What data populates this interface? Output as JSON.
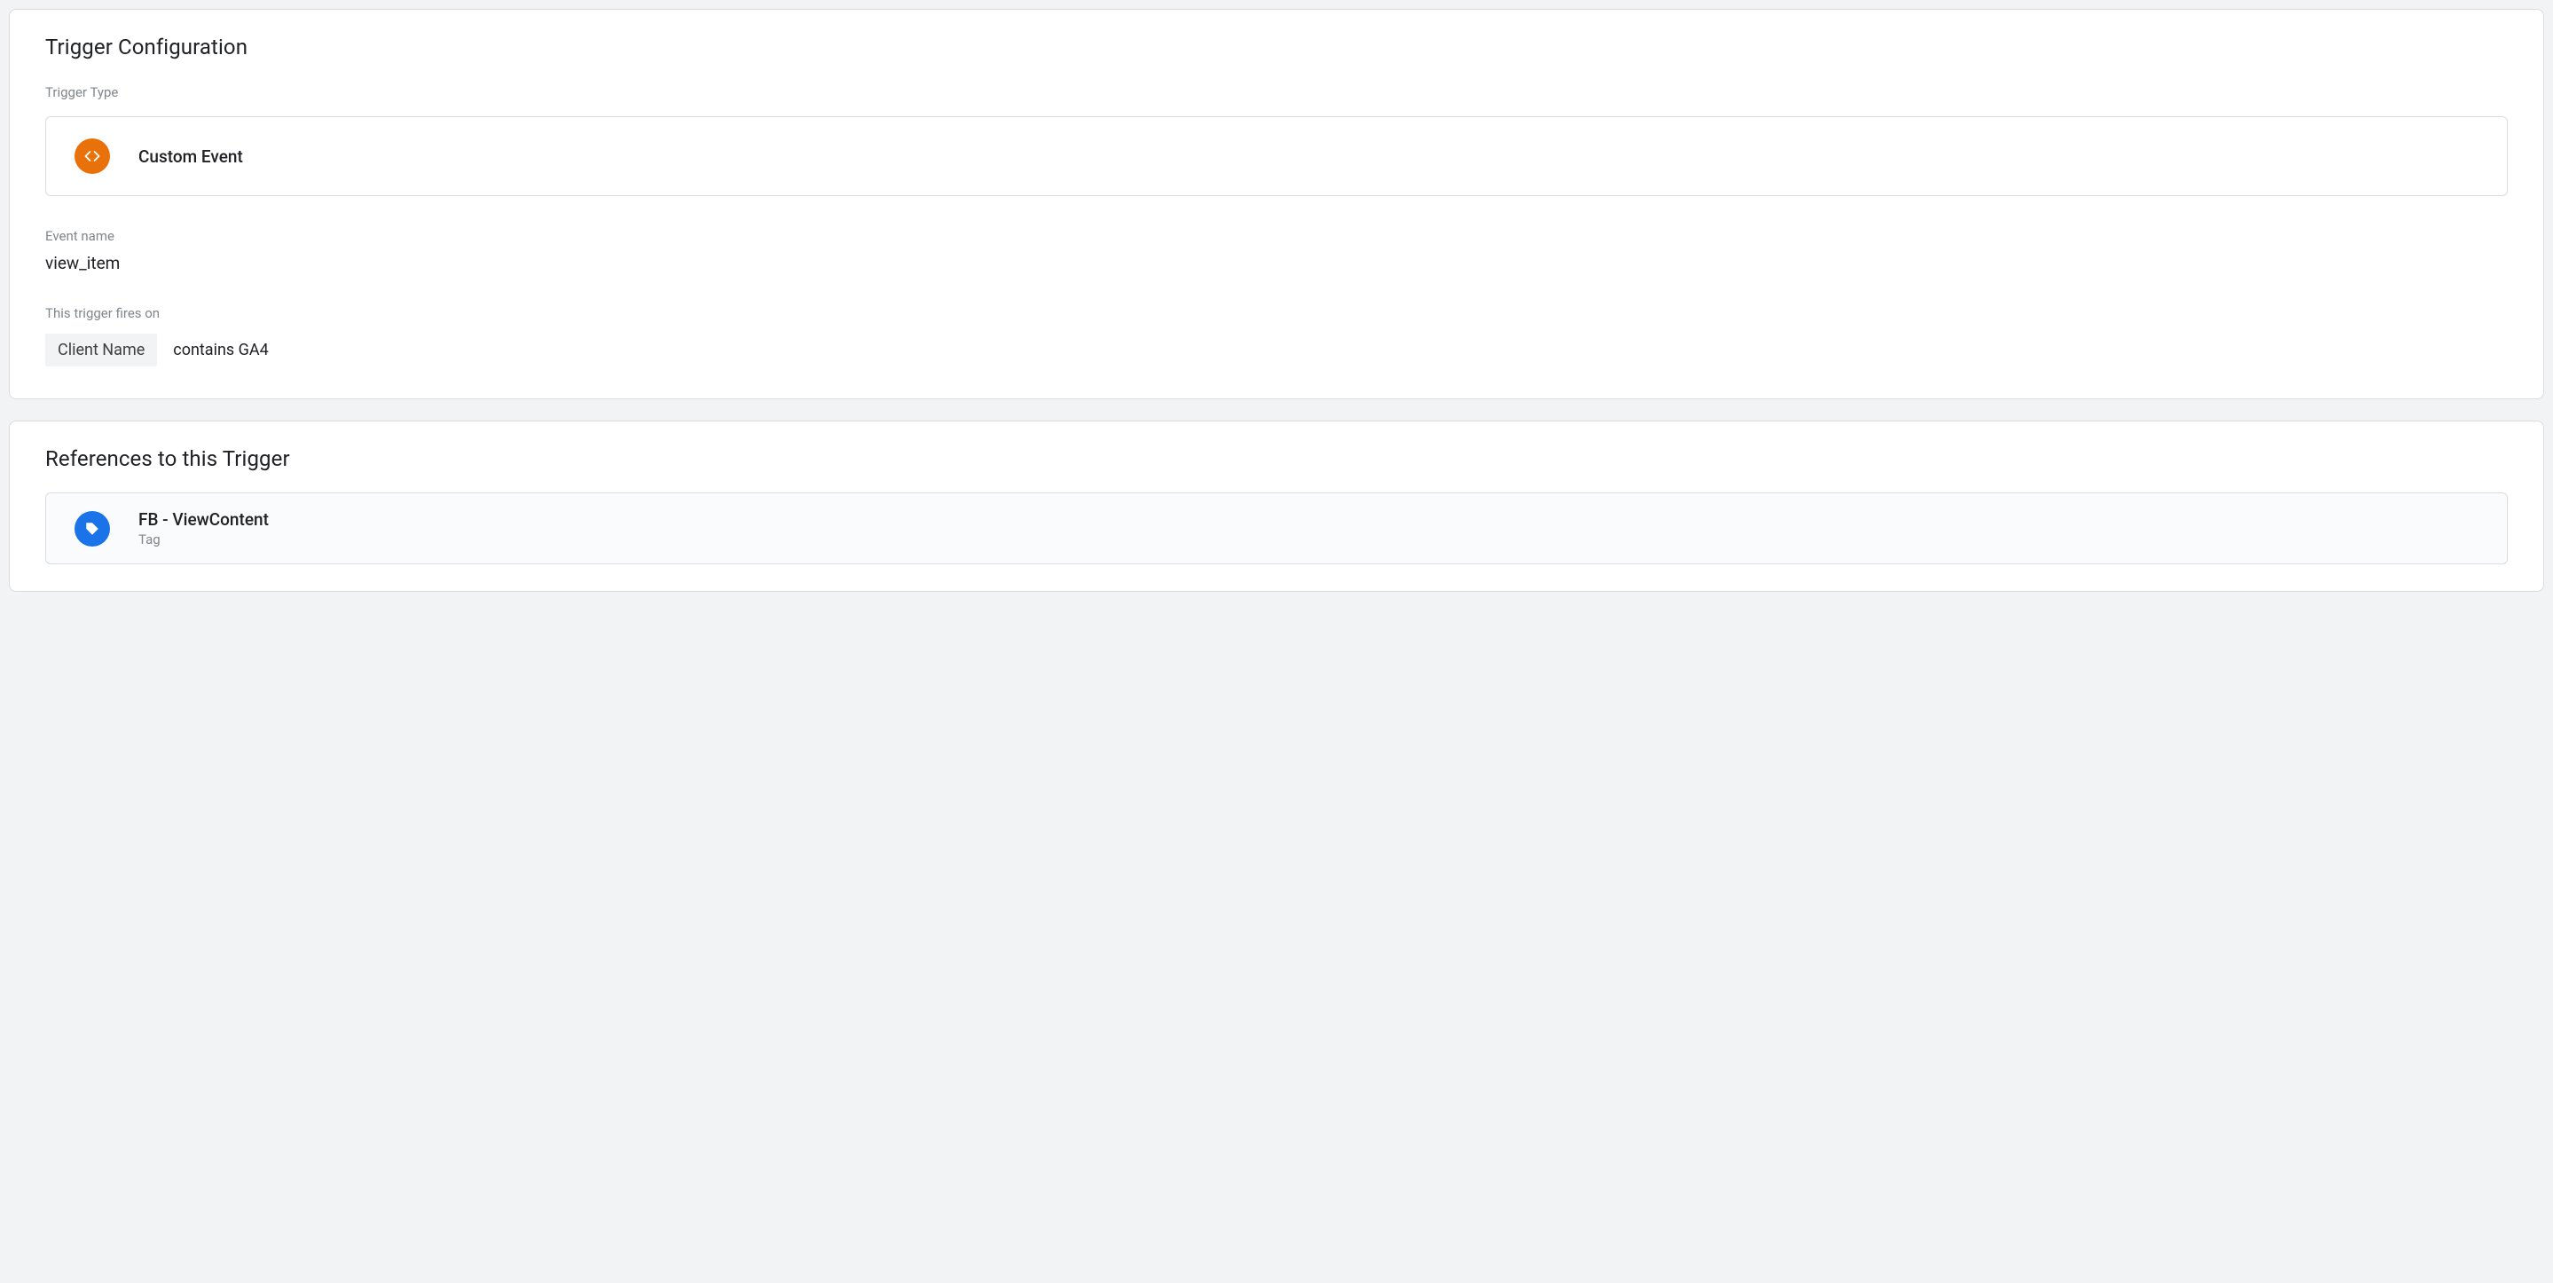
{
  "trigger_config": {
    "title": "Trigger Configuration",
    "type_label": "Trigger Type",
    "type_name": "Custom Event",
    "event_name_label": "Event name",
    "event_name_value": "view_item",
    "fires_on_label": "This trigger fires on",
    "fires_on_variable": "Client Name",
    "fires_on_condition": "contains GA4"
  },
  "references": {
    "title": "References to this Trigger",
    "items": [
      {
        "name": "FB - ViewContent",
        "kind": "Tag"
      }
    ]
  },
  "colors": {
    "custom_event_icon": "#e8710a",
    "tag_icon": "#1a73e8"
  }
}
